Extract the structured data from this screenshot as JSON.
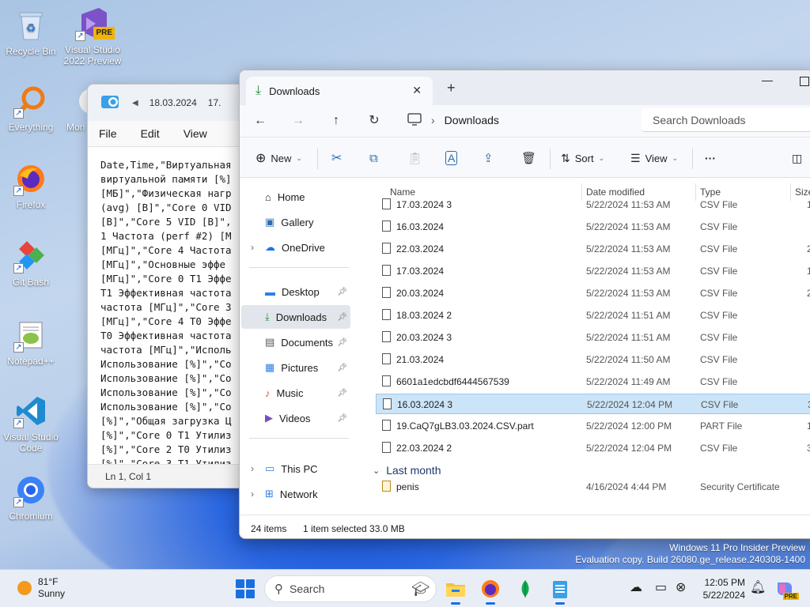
{
  "desktop": {
    "icons": [
      {
        "label": "Recycle Bin"
      },
      {
        "label": "Visual Studio 2022 Preview",
        "badge": "PRE"
      },
      {
        "label": "Everything"
      },
      {
        "label": "Mon"
      },
      {
        "label": "Firefox"
      },
      {
        "label": "Git Bash"
      },
      {
        "label": "Notepad++"
      },
      {
        "label": "Visual Studio Code"
      },
      {
        "label": "Chromium"
      }
    ],
    "watermark": {
      "line1": "Windows 11 Pro Insider Preview",
      "line2": "Evaluation copy. Build 26080.ge_release.240308-1400"
    }
  },
  "notepad": {
    "tabs": [
      "18.03.2024",
      "17."
    ],
    "menu": {
      "file": "File",
      "edit": "Edit",
      "view": "View"
    },
    "lines": [
      "Date,Time,\"Виртуальная",
      "виртуальной памяти [%]",
      "[МБ]\",\"Физическая нагр",
      "(avg) [В]\",\"Core 0 VID",
      "[В]\",\"Core 5 VID [В]\",",
      "1 Частота (perf #2) [М",
      "[МГц]\",\"Core 4 Частота",
      "[МГц]\",\"Основные эффе",
      "[МГц]\",\"Core 0 T1 Эффе",
      "T1 Эффективная частота",
      "частота [МГц]\",\"Core 3",
      "[МГц]\",\"Core 4 T0 Эффе",
      "T0 Эффективная частота",
      "частота [МГц]\",\"Исполь",
      "Использование [%]\",\"Co",
      "Использование [%]\",\"Co",
      "Использование [%]\",\"Co",
      "Использование [%]\",\"Co",
      "[%]\",\"Общая загрузка Ц",
      "[%]\",\"Core 0 T1 Утилиз",
      "[%]\",\"Core 2 T0 Утилиз",
      "[%]\",\"Core 3 T1 Утилиз"
    ],
    "status": "Ln 1, Col 1"
  },
  "explorer": {
    "tab_title": "Downloads",
    "breadcrumb": "Downloads",
    "search_placeholder": "Search Downloads",
    "toolbar": {
      "new": "New",
      "sort": "Sort",
      "view": "View",
      "more": "···"
    },
    "nav": {
      "home": "Home",
      "gallery": "Gallery",
      "onedrive": "OneDrive",
      "desktop": "Desktop",
      "downloads": "Downloads",
      "documents": "Documents",
      "pictures": "Pictures",
      "music": "Music",
      "videos": "Videos",
      "thispc": "This PC",
      "network": "Network"
    },
    "columns": {
      "name": "Name",
      "date": "Date modified",
      "type": "Type",
      "size": "Size"
    },
    "files": [
      {
        "name": "17.03.2024 3",
        "date": "5/22/2024 11:53 AM",
        "type": "CSV File",
        "size": "1"
      },
      {
        "name": "16.03.2024",
        "date": "5/22/2024 11:53 AM",
        "type": "CSV File",
        "size": ""
      },
      {
        "name": "22.03.2024",
        "date": "5/22/2024 11:53 AM",
        "type": "CSV File",
        "size": "2"
      },
      {
        "name": "17.03.2024",
        "date": "5/22/2024 11:53 AM",
        "type": "CSV File",
        "size": "1"
      },
      {
        "name": "20.03.2024",
        "date": "5/22/2024 11:53 AM",
        "type": "CSV File",
        "size": "2"
      },
      {
        "name": "18.03.2024 2",
        "date": "5/22/2024 11:51 AM",
        "type": "CSV File",
        "size": ""
      },
      {
        "name": "20.03.2024 3",
        "date": "5/22/2024 11:51 AM",
        "type": "CSV File",
        "size": ""
      },
      {
        "name": "21.03.2024",
        "date": "5/22/2024 11:50 AM",
        "type": "CSV File",
        "size": ""
      },
      {
        "name": "6601a1edcbdf6444567539",
        "date": "5/22/2024 11:49 AM",
        "type": "CSV File",
        "size": ""
      },
      {
        "name": "16.03.2024 3",
        "date": "5/22/2024 12:04 PM",
        "type": "CSV File",
        "size": "3"
      },
      {
        "name": "19.CaQ7gLB3.03.2024.CSV.part",
        "date": "5/22/2024 12:00 PM",
        "type": "PART File",
        "size": "1"
      },
      {
        "name": "22.03.2024 2",
        "date": "5/22/2024 12:04 PM",
        "type": "CSV File",
        "size": "3"
      }
    ],
    "group_last_month": "Last month",
    "last_month_files": [
      {
        "name": "penis",
        "date": "4/16/2024 4:44 PM",
        "type": "Security Certificate",
        "size": ""
      }
    ],
    "status": {
      "count": "24 items",
      "selected": "1 item selected  33.0 MB"
    }
  },
  "taskbar": {
    "weather_temp": "81°F",
    "weather_desc": "Sunny",
    "search_label": "Search",
    "time": "12:05 PM",
    "date": "5/22/2024",
    "copilot_badge": "PRE"
  }
}
